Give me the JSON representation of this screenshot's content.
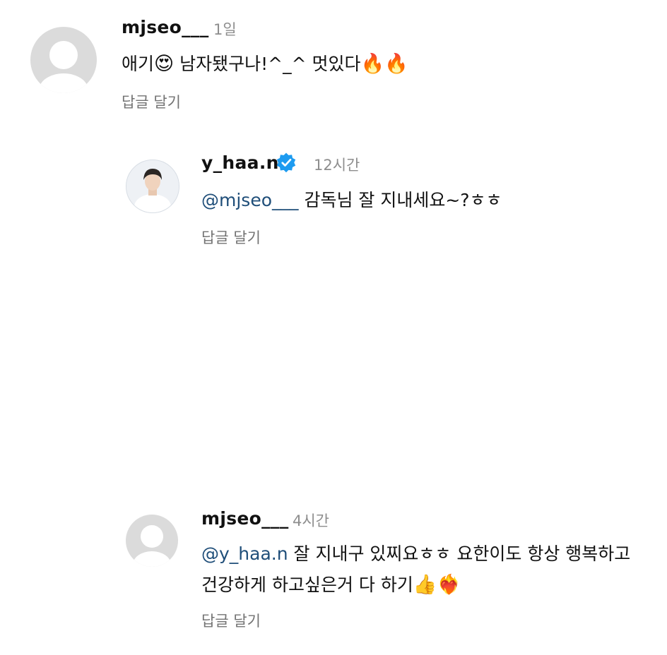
{
  "comments": [
    {
      "username": "mjseo___",
      "time": "1일",
      "text_pre": "애기",
      "emoji_1": "😍",
      "text_post": " 남자됐구나!^_^ 멋있다",
      "emoji_2": "🔥🔥",
      "reply_label": "답글 달기"
    },
    {
      "username": "y_haa.n",
      "verified_icon": "verified-badge-icon",
      "time": "12시간",
      "mention": "@mjseo___",
      "text": " 감독님 잘 지내세요~?ㅎㅎ",
      "reply_label": "답글 달기"
    },
    {
      "username": "mjseo___",
      "time": "4시간",
      "mention": "@y_haa.n",
      "text_line1": " 잘 지내구 있찌요ㅎㅎ 요한이도 항상 행복하고",
      "text_line2": "건강하게 하고싶은거 다 하기",
      "emoji": "👍❤️‍🔥",
      "reply_label": "답글 달기"
    }
  ],
  "colors": {
    "mention": "#1f4e79",
    "verified": "#1d9bf0",
    "muted": "#8e8e8e",
    "avatar_default": "#dbdbdb"
  }
}
